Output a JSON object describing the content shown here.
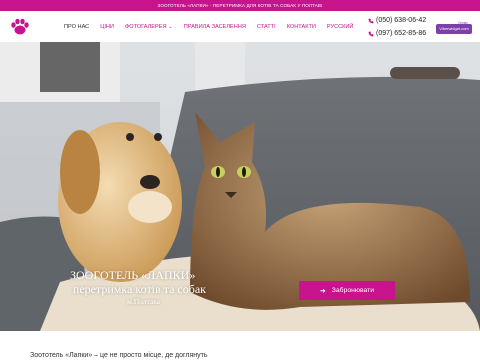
{
  "topbar": {
    "text": "ЗООГОТЕЛЬ «ЛАПКИ» - ПЕРЕТРИМКА ДЛЯ КОТІВ ТА СОБАК У ПОЛТАВІ"
  },
  "header": {
    "logo_icon": "paw-icon",
    "nav": [
      {
        "label": "ПРО НАС"
      },
      {
        "label": "ЦІНИ"
      },
      {
        "label": "ФОТОГАЛЕРЕЯ ⌄"
      },
      {
        "label": "ПРАВИЛА ЗАСЕЛЕННЯ"
      },
      {
        "label": "СТАТТІ"
      },
      {
        "label": "КОНТАКТИ"
      },
      {
        "label": "РУССКИЙ"
      }
    ],
    "phones": [
      "(050) 638-06-42",
      "(097) 652-85-86"
    ],
    "badge": {
      "top": "Сервіс",
      "label": "Viberwidget.com"
    }
  },
  "hero": {
    "title": "ЗООГОТЕЛЬ «ЛАПКИ»",
    "subtitle": "перетримка котів та собак",
    "city": "м.Полтава",
    "cta": "Забронювати"
  },
  "bottom": {
    "text": "Зоототель «Лапки» – це не просто місце, де доглянуть"
  },
  "colors": {
    "accent": "#c8148c",
    "badge": "#7d3fa8"
  }
}
